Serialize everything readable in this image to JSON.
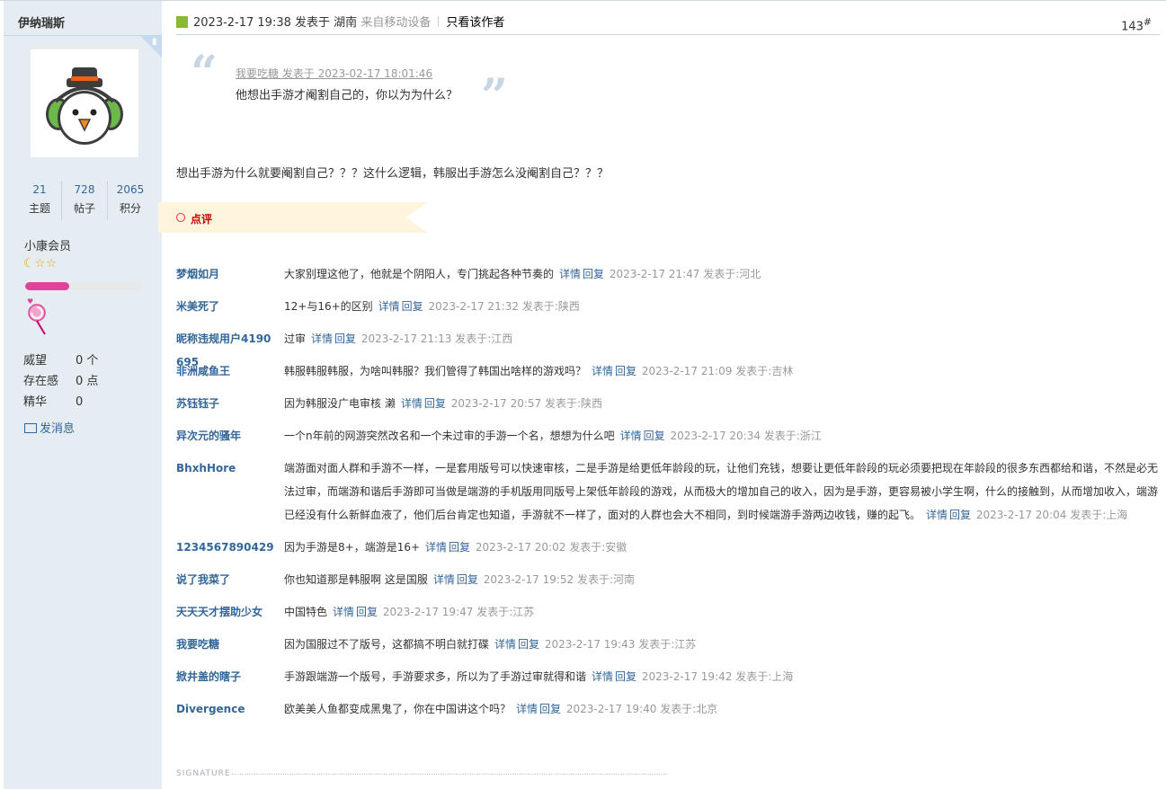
{
  "user": {
    "name": "伊纳瑞斯",
    "stats": [
      {
        "num": "21",
        "label": "主题"
      },
      {
        "num": "728",
        "label": "帖子"
      },
      {
        "num": "2065",
        "label": "积分"
      }
    ],
    "group": "小康会员",
    "stars": "☾☆☆",
    "level_progress": 0.38,
    "info": [
      {
        "key": "威望",
        "val": "0 个"
      },
      {
        "key": "存在感",
        "val": "0 点"
      },
      {
        "key": "精华",
        "val": "0"
      }
    ],
    "send_message": "发消息"
  },
  "post": {
    "datetime": "2023-2-17 19:38",
    "posted_in": "发表于",
    "location": "湖南",
    "device": "来自移动设备",
    "only_author": "只看该作者",
    "floor": "143",
    "floor_mark": "#",
    "quote_header": "我要吃糖 发表于 2023-02-17 18:01:46",
    "quote_body": "他想出手游才阉割自己的，你以为为什么？",
    "message": "想出手游为什么就要阉割自己？？？这什么逻辑，韩服出手游怎么没阉割自己？？？",
    "comments_title": "点评",
    "signature": "SIGNATURE"
  },
  "labels": {
    "detail": "详情",
    "reply": "回复"
  },
  "comments": [
    {
      "author": "梦烟如月",
      "text": "大家别理这他了，他就是个阴阳人，专门挑起各种节奏的",
      "time": "2023-2-17 21:47 发表于:河北"
    },
    {
      "author": "米美死了",
      "text": "12+与16+的区别",
      "time": "2023-2-17 21:32 发表于:陕西"
    },
    {
      "author": "昵称违规用户4190695",
      "text": "过审",
      "time": "2023-2-17 21:13 发表于:江西"
    },
    {
      "author": "非洲咸鱼王",
      "text": "韩服韩服韩服，为啥叫韩服？我们管得了韩国出啥样的游戏吗？",
      "time": "2023-2-17 21:09 发表于:吉林"
    },
    {
      "author": "苏钰钰子",
      "text": "因为韩服没广电审核 濑",
      "time": "2023-2-17 20:57 发表于:陕西"
    },
    {
      "author": "异次元的骚年",
      "text": "一个n年前的网游突然改名和一个未过审的手游一个名，想想为什么吧",
      "time": "2023-2-17 20:34 发表于:浙江"
    },
    {
      "author": "BhxhHore",
      "text": "端游面对面人群和手游不一样，一是套用版号可以快速审核，二是手游是给更低年龄段的玩，让他们充钱，想要让更低年龄段的玩必须要把现在年龄段的很多东西都给和谐，不然是必无法过审，而端游和谐后手游即可当做是端游的手机版用同版号上架低年龄段的游戏，从而极大的增加自己的收入，因为是手游，更容易被小学生啊，什么的接触到，从而增加收入，端游已经没有什么新鲜血液了，他们后台肯定也知道，手游就不一样了，面对的人群也会大不相同，到时候端游手游两边收钱，赚的起飞。",
      "time": "2023-2-17 20:04 发表于:上海"
    },
    {
      "author": "1234567890429",
      "text": "因为手游是8+，端游是16+",
      "time": "2023-2-17 20:02 发表于:安徽"
    },
    {
      "author": "说了我菜了",
      "text": "你也知道那是韩服啊 这是国服",
      "time": "2023-2-17 19:52 发表于:河南"
    },
    {
      "author": "天天天才摆助少女",
      "text": "中国特色",
      "time": "2023-2-17 19:47 发表于:江苏"
    },
    {
      "author": "我要吃糖",
      "text": "因为国服过不了版号，这都搞不明白就打碟",
      "time": "2023-2-17 19:43 发表于:江苏"
    },
    {
      "author": "掀井盖的瞎子",
      "text": "手游跟端游一个版号，手游要求多，所以为了手游过审就得和谐",
      "time": "2023-2-17 19:42 发表于:上海"
    },
    {
      "author": "Divergence",
      "text": "欧美美人鱼都变成黑鬼了，你在中国讲这个吗？",
      "time": "2023-2-17 19:40 发表于:北京"
    }
  ]
}
